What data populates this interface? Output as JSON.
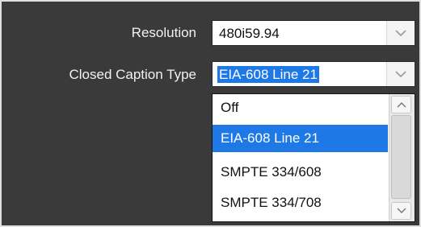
{
  "resolution": {
    "label": "Resolution",
    "value": "480i59.94"
  },
  "caption_type": {
    "label": "Closed Caption Type",
    "value": "EIA-608 Line 21",
    "options": [
      "Off",
      "EIA-608 Line 21",
      "SMPTE 334/608",
      "SMPTE 334/708"
    ],
    "selected_index": 1
  },
  "icons": {
    "dropdown_arrow": "chevron-down-icon",
    "scroll_up": "chevron-up-icon",
    "scroll_down": "chevron-down-icon"
  },
  "colors": {
    "background": "#3a3a3a",
    "selection": "#1e78e6"
  }
}
